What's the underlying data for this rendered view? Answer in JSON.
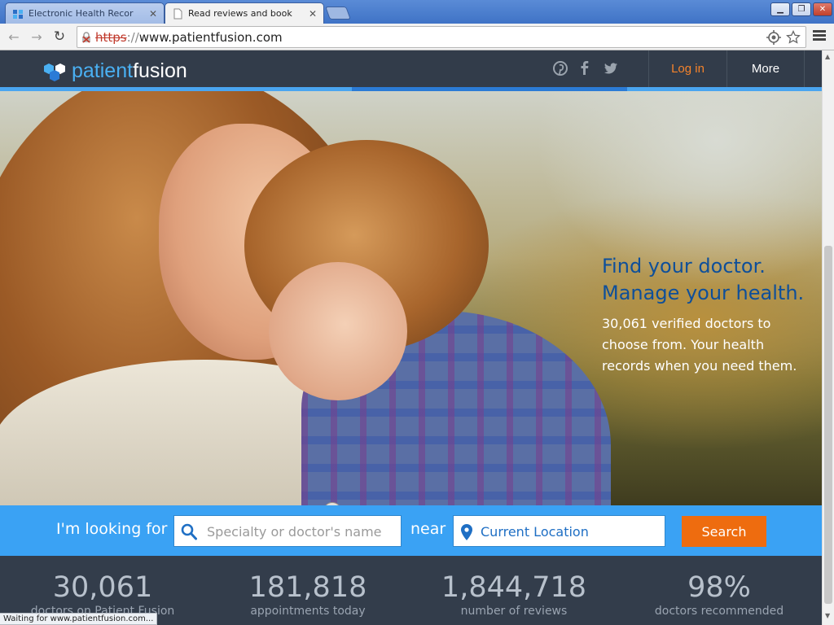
{
  "browser": {
    "tabs": [
      {
        "title": "Electronic Health Recor",
        "active": false
      },
      {
        "title": "Read reviews and book",
        "active": true
      }
    ],
    "url": {
      "scheme": "https",
      "separator": "://",
      "rest": "www.patientfusion.com"
    },
    "status_text": "Waiting for www.patientfusion.com..."
  },
  "site": {
    "logo": {
      "word1": "patient",
      "word2": "fusion"
    },
    "social_icons": [
      "pinterest-icon",
      "facebook-icon",
      "twitter-icon"
    ],
    "nav": {
      "login": "Log in",
      "more": "More"
    },
    "colors": {
      "header_bg": "#323c4a",
      "accent_blue": "#3aa2f4",
      "login_orange": "#f5832b",
      "search_button": "#ee6c0f"
    }
  },
  "hero": {
    "heading_line1": "Find your doctor.",
    "heading_line2": "Manage your health.",
    "body_line1": "30,061 verified doctors to",
    "body_line2": "choose from. Your health",
    "body_line3": "records when you need them."
  },
  "search": {
    "looking_for_label": "I'm looking for",
    "specialty_placeholder": "Specialty or doctor's name",
    "near_label": "near",
    "location_value": "Current Location",
    "button_label": "Search"
  },
  "stats": [
    {
      "value": "30,061",
      "label": "doctors on Patient Fusion"
    },
    {
      "value": "181,818",
      "label": "appointments today"
    },
    {
      "value": "1,844,718",
      "label": "number of reviews"
    },
    {
      "value": "98%",
      "label": "doctors recommended"
    }
  ]
}
